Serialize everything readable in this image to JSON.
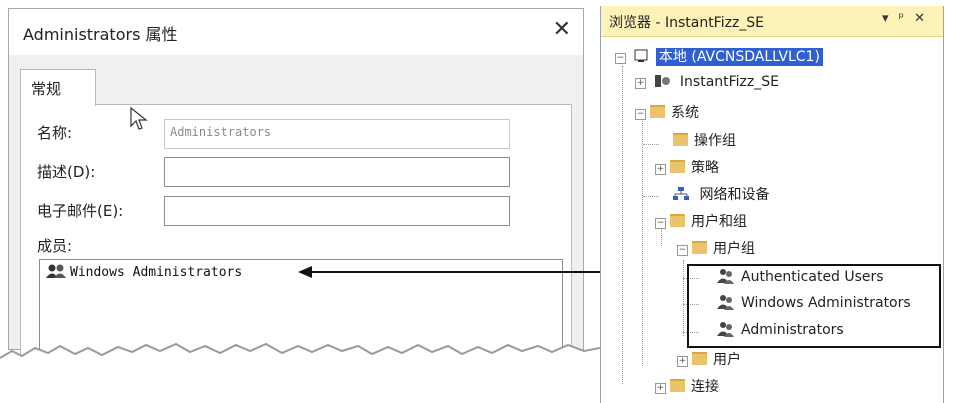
{
  "dialog": {
    "title": "Administrators 属性",
    "close_glyph": "✕",
    "tab_general": "常规",
    "name_label": "名称:",
    "name_value": "Administrators",
    "desc_label": "描述(D):",
    "desc_value": "",
    "email_label": "电子邮件(E):",
    "email_value": "",
    "members_label": "成员:",
    "members": [
      {
        "name": "Windows Administrators",
        "icon": "group-icon"
      }
    ]
  },
  "browser": {
    "title": "浏览器 - InstantFizz_SE",
    "controls": {
      "dropdown": "▾",
      "pin": "ᵖ",
      "close": "✕"
    },
    "tree": {
      "root": "本地 (AVCNSDALLVLC1)",
      "instant_fizz": "InstantFizz_SE",
      "system": "系统",
      "operation_group": "操作组",
      "policy": "策略",
      "network_devices": "网络和设备",
      "users_groups": "用户和组",
      "user_groups": "用户组",
      "auth_users": "Authenticated Users",
      "win_admins": "Windows Administrators",
      "admins": "Administrators",
      "users": "用户",
      "connections": "连接"
    }
  },
  "colors": {
    "selection": "#2f5fd0",
    "browser_title_bg": "#fdf3b8",
    "folder": "#e9c46a"
  }
}
